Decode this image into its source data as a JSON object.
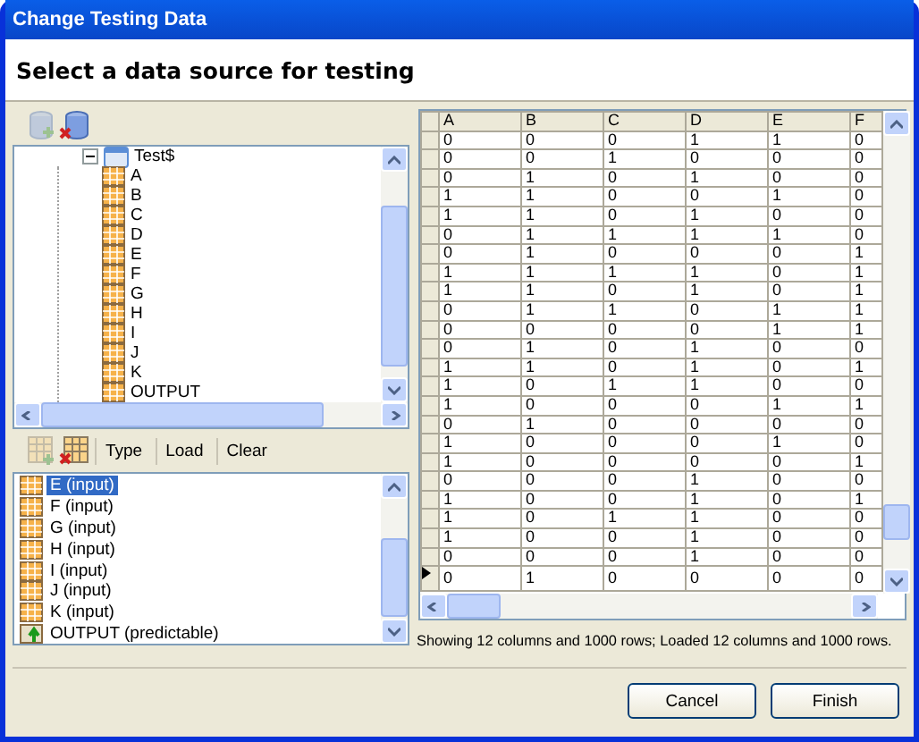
{
  "window": {
    "title": "Change Testing Data"
  },
  "heading": "Select a data source for testing",
  "source_toolbar": [
    {
      "kind": "add",
      "disabled": true
    },
    {
      "kind": "remove",
      "disabled": false
    }
  ],
  "tree": [
    {
      "label": "Test$",
      "expanded": true,
      "children": [
        {
          "label": "A"
        },
        {
          "label": "B"
        },
        {
          "label": "C"
        },
        {
          "label": "D"
        },
        {
          "label": "E"
        },
        {
          "label": "F"
        },
        {
          "label": "G"
        },
        {
          "label": "H"
        },
        {
          "label": "I"
        },
        {
          "label": "J"
        },
        {
          "label": "K"
        },
        {
          "label": "OUTPUT"
        }
      ]
    }
  ],
  "column_toolbar": {
    "icons": [
      {
        "kind": "add",
        "disabled": true
      },
      {
        "kind": "remove",
        "disabled": false
      }
    ],
    "buttons": [
      "Type",
      "Load",
      "Clear"
    ]
  },
  "columns_list": [
    {
      "label": "E (input)",
      "kind": "input",
      "selected": true
    },
    {
      "label": "F (input)",
      "kind": "input",
      "selected": false
    },
    {
      "label": "G (input)",
      "kind": "input",
      "selected": false
    },
    {
      "label": "H (input)",
      "kind": "input",
      "selected": false
    },
    {
      "label": "I (input)",
      "kind": "input",
      "selected": false
    },
    {
      "label": "J (input)",
      "kind": "input",
      "selected": false
    },
    {
      "label": "K (input)",
      "kind": "input",
      "selected": false
    },
    {
      "label": "OUTPUT (predictable)",
      "kind": "output",
      "selected": false
    }
  ],
  "table": {
    "columns": [
      "A",
      "B",
      "C",
      "D",
      "E",
      "F"
    ],
    "rows": [
      {
        "cells": [
          "0",
          "0",
          "0",
          "1",
          "1",
          "0"
        ],
        "current": false
      },
      {
        "cells": [
          "0",
          "0",
          "1",
          "0",
          "0",
          "0"
        ],
        "current": false
      },
      {
        "cells": [
          "0",
          "1",
          "0",
          "1",
          "0",
          "0"
        ],
        "current": false
      },
      {
        "cells": [
          "1",
          "1",
          "0",
          "0",
          "1",
          "0"
        ],
        "current": false
      },
      {
        "cells": [
          "1",
          "1",
          "0",
          "1",
          "0",
          "0"
        ],
        "current": false
      },
      {
        "cells": [
          "0",
          "1",
          "1",
          "1",
          "1",
          "0"
        ],
        "current": false
      },
      {
        "cells": [
          "0",
          "1",
          "0",
          "0",
          "0",
          "1"
        ],
        "current": false
      },
      {
        "cells": [
          "1",
          "1",
          "1",
          "1",
          "0",
          "1"
        ],
        "current": false
      },
      {
        "cells": [
          "1",
          "1",
          "0",
          "1",
          "0",
          "1"
        ],
        "current": false
      },
      {
        "cells": [
          "0",
          "1",
          "1",
          "0",
          "1",
          "1"
        ],
        "current": false
      },
      {
        "cells": [
          "0",
          "0",
          "0",
          "0",
          "1",
          "1"
        ],
        "current": false
      },
      {
        "cells": [
          "0",
          "1",
          "0",
          "1",
          "0",
          "0"
        ],
        "current": false
      },
      {
        "cells": [
          "1",
          "1",
          "0",
          "1",
          "0",
          "1"
        ],
        "current": false
      },
      {
        "cells": [
          "1",
          "0",
          "1",
          "1",
          "0",
          "0"
        ],
        "current": false
      },
      {
        "cells": [
          "1",
          "0",
          "0",
          "0",
          "1",
          "1"
        ],
        "current": false
      },
      {
        "cells": [
          "0",
          "1",
          "0",
          "0",
          "0",
          "0"
        ],
        "current": false
      },
      {
        "cells": [
          "1",
          "0",
          "0",
          "0",
          "1",
          "0"
        ],
        "current": false
      },
      {
        "cells": [
          "1",
          "0",
          "0",
          "0",
          "0",
          "1"
        ],
        "current": false
      },
      {
        "cells": [
          "0",
          "0",
          "0",
          "1",
          "0",
          "0"
        ],
        "current": false
      },
      {
        "cells": [
          "1",
          "0",
          "0",
          "1",
          "0",
          "1"
        ],
        "current": false
      },
      {
        "cells": [
          "1",
          "0",
          "1",
          "1",
          "0",
          "0"
        ],
        "current": false
      },
      {
        "cells": [
          "1",
          "0",
          "0",
          "1",
          "0",
          "0"
        ],
        "current": false
      },
      {
        "cells": [
          "0",
          "0",
          "0",
          "1",
          "0",
          "0"
        ],
        "current": false
      },
      {
        "cells": [
          "0",
          "1",
          "0",
          "0",
          "0",
          "0"
        ],
        "current": true
      }
    ]
  },
  "status": "Showing 12 columns and 1000 rows; Loaded 12 columns and 1000 rows.",
  "buttons": [
    {
      "label": "Cancel"
    },
    {
      "label": "Finish"
    }
  ]
}
